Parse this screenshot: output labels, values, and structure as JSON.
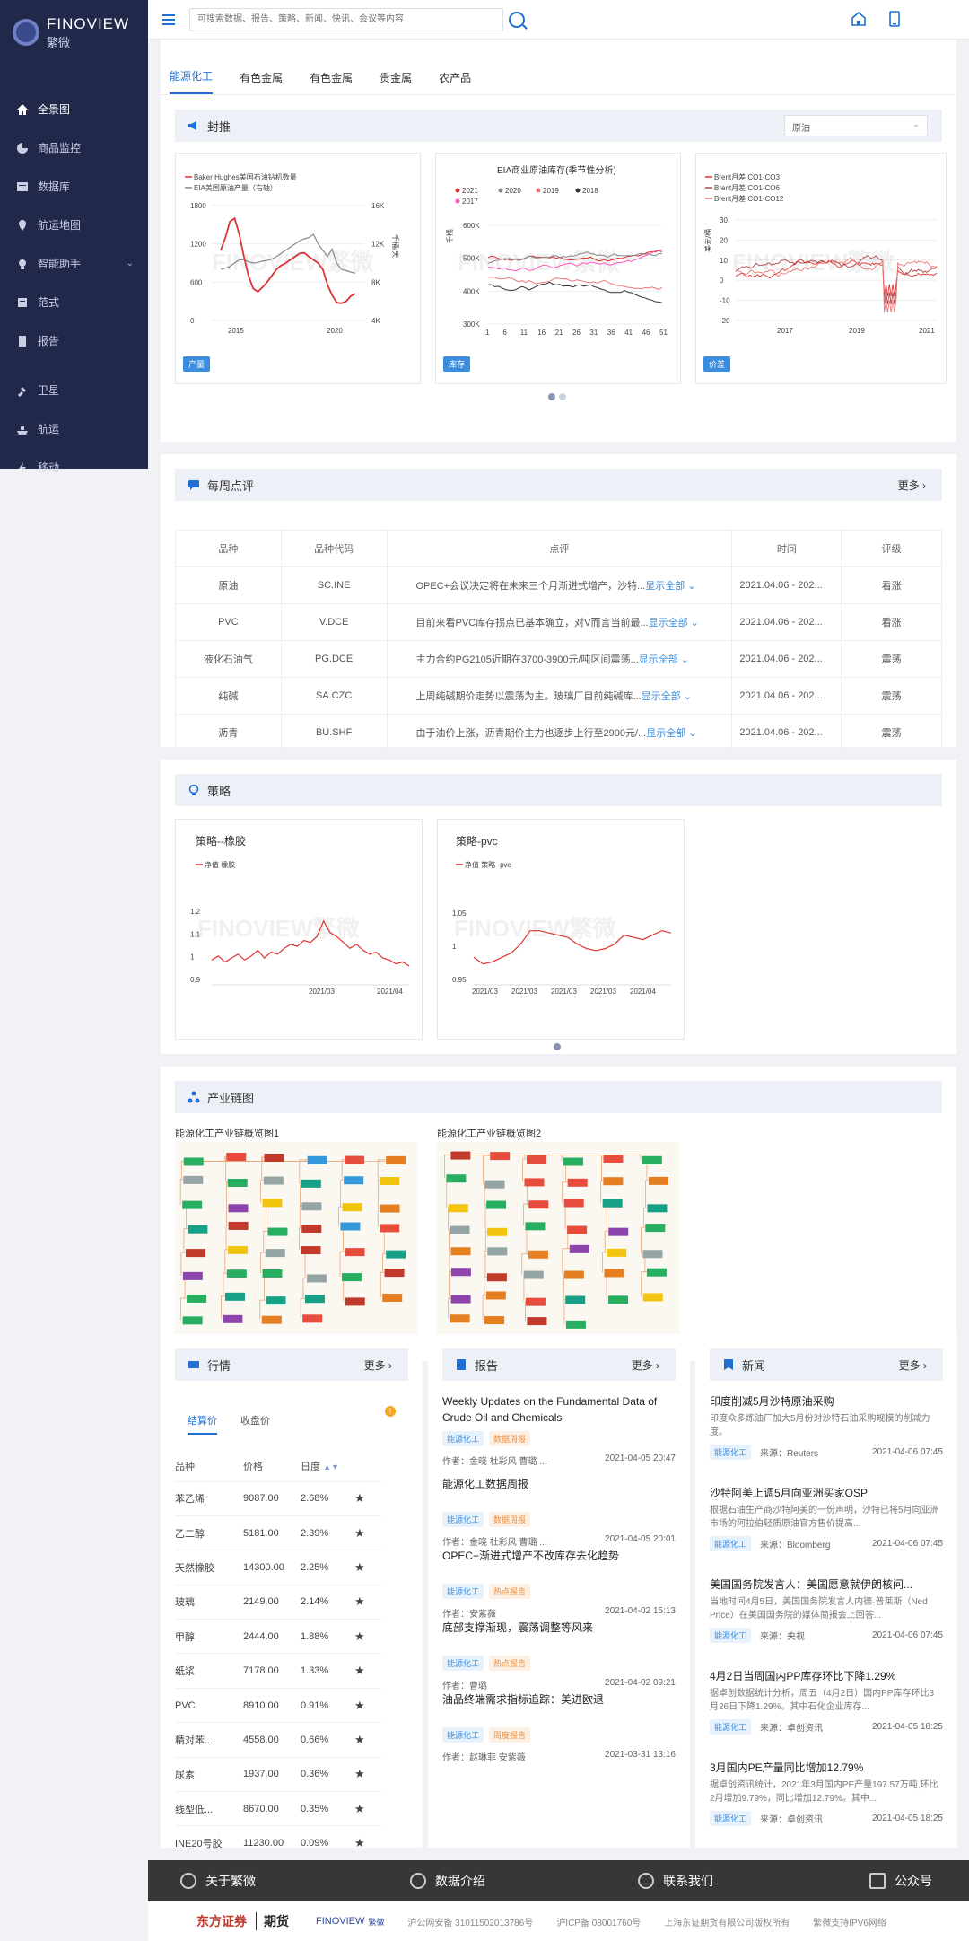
{
  "brand": {
    "en": "FINOVIEW",
    "cn": "繁微"
  },
  "sidebar": {
    "items": [
      {
        "label": "全景图",
        "icon": "home-icon"
      },
      {
        "label": "商品监控",
        "icon": "pie-icon"
      },
      {
        "label": "数据库",
        "icon": "database-icon"
      },
      {
        "label": "航运地图",
        "icon": "map-pin-icon"
      },
      {
        "label": "智能助手",
        "icon": "bulb-icon"
      },
      {
        "label": "范式",
        "icon": "book-icon"
      },
      {
        "label": "报告",
        "icon": "report-icon"
      },
      {
        "label": "卫星",
        "icon": "satellite-icon"
      },
      {
        "label": "航运",
        "icon": "ship-icon"
      },
      {
        "label": "移动",
        "icon": "mobile-icon"
      }
    ]
  },
  "header": {
    "search_placeholder": "可搜索数据、报告、策略、新闻、快讯、会议等内容"
  },
  "tabs": [
    "能源化工",
    "有色金属",
    "有色金属",
    "贵金属",
    "农产品"
  ],
  "feng": {
    "title": "封推",
    "select": "原油",
    "cards": [
      {
        "legend": [
          "Baker Hughes美国石油钻机数量",
          "EIA美国原油产量（右轴）"
        ],
        "badge": "产量",
        "y_left": [
          "1800",
          "1200",
          "600",
          "0"
        ],
        "y_right": [
          "16K",
          "12K",
          "8K",
          "4K"
        ],
        "x": [
          "2015",
          "2020"
        ],
        "yr_label": "千桶/天"
      },
      {
        "title": "EIA商业原油库存(季节性分析)",
        "legend": [
          "2021",
          "2020",
          "2019",
          "2018",
          "2017"
        ],
        "badge": "库存",
        "y": [
          "600K",
          "500K",
          "400K",
          "300K"
        ],
        "x": [
          "1",
          "6",
          "11",
          "16",
          "21",
          "26",
          "31",
          "36",
          "41",
          "46",
          "51"
        ],
        "yl_label": "千桶"
      },
      {
        "legend": [
          "Brent月差 CO1-CO3",
          "Brent月差 CO1-CO6",
          "Brent月差 CO1-CO12"
        ],
        "badge": "价差",
        "y": [
          "30",
          "20",
          "10",
          "0",
          "-10",
          "-20"
        ],
        "x": [
          "2017",
          "2019",
          "2021"
        ],
        "yl_label": "美元/桶"
      }
    ],
    "watermark": "FINOVIEW繁微"
  },
  "weekly": {
    "title": "每周点评",
    "more": "更多",
    "headers": [
      "品种",
      "品种代码",
      "点评",
      "时间",
      "评级"
    ],
    "rows": [
      [
        "原油",
        "SC.INE",
        "OPEC+会议决定将在未来三个月渐进式增产，沙特...",
        "2021.04.06 - 202...",
        "看涨"
      ],
      [
        "PVC",
        "V.DCE",
        "目前来看PVC库存拐点已基本确立，对V而言当前最...",
        "2021.04.06 - 202...",
        "看涨"
      ],
      [
        "液化石油气",
        "PG.DCE",
        "主力合约PG2105近期在3700-3900元/吨区间震荡...",
        "2021.04.06 - 202...",
        "震荡"
      ],
      [
        "纯碱",
        "SA.CZC",
        "上周纯碱期价走势以震荡为主。玻璃厂目前纯碱库...",
        "2021.04.06 - 202...",
        "震荡"
      ],
      [
        "沥青",
        "BU.SHF",
        "由于油价上涨，沥青期价主力也逐步上行至2900元/...",
        "2021.04.06 - 202...",
        "震荡"
      ]
    ],
    "show_all": "显示全部"
  },
  "strategy": {
    "title": "策略",
    "cards": [
      {
        "title": "策略--橡胶",
        "legend": "净值 橡胶",
        "y": [
          "1.2",
          "1.1",
          "1",
          "0.9"
        ],
        "x": [
          "2021/03",
          "2021/04"
        ]
      },
      {
        "title": "策略-pvc",
        "legend": "净值 策略 -pvc",
        "y": [
          "1.05",
          "1",
          "0.95"
        ],
        "x": [
          "2021/03",
          "2021/03",
          "2021/03",
          "2021/03",
          "2021/04"
        ]
      }
    ]
  },
  "chain": {
    "title": "产业链图",
    "items": [
      "能源化工产业链概览图1",
      "能源化工产业链概览图2"
    ]
  },
  "market": {
    "title": "行情",
    "more": "更多",
    "tabs": [
      "结算价",
      "收盘价"
    ],
    "headers": [
      "品种",
      "价格",
      "日度"
    ],
    "rows": [
      [
        "苯乙烯",
        "9087.00",
        "2.68%"
      ],
      [
        "乙二醇",
        "5181.00",
        "2.39%"
      ],
      [
        "天然橡胶",
        "14300.00",
        "2.25%"
      ],
      [
        "玻璃",
        "2149.00",
        "2.14%"
      ],
      [
        "甲醇",
        "2444.00",
        "1.88%"
      ],
      [
        "纸浆",
        "7178.00",
        "1.33%"
      ],
      [
        "PVC",
        "8910.00",
        "0.91%"
      ],
      [
        "精对苯...",
        "4558.00",
        "0.66%"
      ],
      [
        "尿素",
        "1937.00",
        "0.36%"
      ],
      [
        "线型低...",
        "8670.00",
        "0.35%"
      ],
      [
        "INE20号胶",
        "11230.00",
        "0.09%"
      ]
    ]
  },
  "reports": {
    "title": "报告",
    "more": "更多",
    "items": [
      {
        "title": "Weekly Updates on the Fundamental Data of Crude Oil and Chemicals",
        "tags": [
          "能源化工",
          "数据周报"
        ],
        "author": "作者：金晓 杜彩风 曹璐 ...",
        "time": "2021-04-05 20:47"
      },
      {
        "title": "能源化工数据周报",
        "tags": [
          "能源化工",
          "数据周报"
        ],
        "author": "作者：金晓 杜彩风 曹璐 ...",
        "time": "2021-04-05 20:01"
      },
      {
        "title": "OPEC+渐进式增产不改库存去化趋势",
        "tags": [
          "能源化工",
          "热点报告"
        ],
        "author": "作者：安紫薇",
        "time": "2021-04-02 15:13"
      },
      {
        "title": "底部支撑渐现，震荡调整等风来",
        "tags": [
          "能源化工",
          "热点报告"
        ],
        "author": "作者：曹璐",
        "time": "2021-04-02 09:21"
      },
      {
        "title": "油品终端需求指标追踪：美进欧退",
        "tags": [
          "能源化工",
          "周度报告"
        ],
        "author": "作者：赵琳菲 安紫薇",
        "time": "2021-03-31 13:16"
      }
    ]
  },
  "news": {
    "title": "新闻",
    "more": "更多",
    "items": [
      {
        "title": "印度削减5月沙特原油采购",
        "desc": "印度众多炼油厂加大5月份对沙特石油采购规模的削减力度。",
        "tag": "能源化工",
        "source": "来源：Reuters",
        "time": "2021-04-06 07:45"
      },
      {
        "title": "沙特阿美上调5月向亚洲买家OSP",
        "desc": "根据石油生产商沙特阿美的一份声明，沙特已将5月向亚洲市场的阿拉伯轻质原油官方售价提高...",
        "tag": "能源化工",
        "source": "来源：Bloomberg",
        "time": "2021-04-06 07:45"
      },
      {
        "title": "美国国务院发言人：美国愿意就伊朗核问...",
        "desc": "当地时间4月5日，美国国务院发言人内德·普莱斯（Ned Price）在美国国务院的媒体简报会上回答...",
        "tag": "能源化工",
        "source": "来源：央视",
        "time": "2021-04-06 07:45"
      },
      {
        "title": "4月2日当周国内PP库存环比下降1.29%",
        "desc": "据卓创数据统计分析，周五（4月2日）国内PP库存环比3月26日下降1.29%。其中石化企业库存...",
        "tag": "能源化工",
        "source": "来源：卓创资讯",
        "time": "2021-04-05 18:25"
      },
      {
        "title": "3月国内PE产量同比增加12.79%",
        "desc": "据卓创资讯统计，2021年3月国内PE产量197.57万吨,环比2月增加9.79%，同比增加12.79%。其中...",
        "tag": "能源化工",
        "source": "来源：卓创资讯",
        "time": "2021-04-05 18:25"
      }
    ]
  },
  "footer": {
    "links": [
      "关于繁微",
      "数据介绍",
      "联系我们",
      "公众号"
    ],
    "dfzq": "东方证券",
    "qh": "期货",
    "finoview": "FINOVIEW",
    "cn": "繁微",
    "icp1": "沪公网安备 31011502013786号",
    "icp2": "沪ICP备 08001760号",
    "copyright": "上海东证期货有限公司版权所有",
    "ipv6": "繁微支持IPV6网络"
  },
  "colors": {
    "sidebar": "#21284a",
    "accent": "#1e6fd6",
    "red": "#e03b3b"
  }
}
